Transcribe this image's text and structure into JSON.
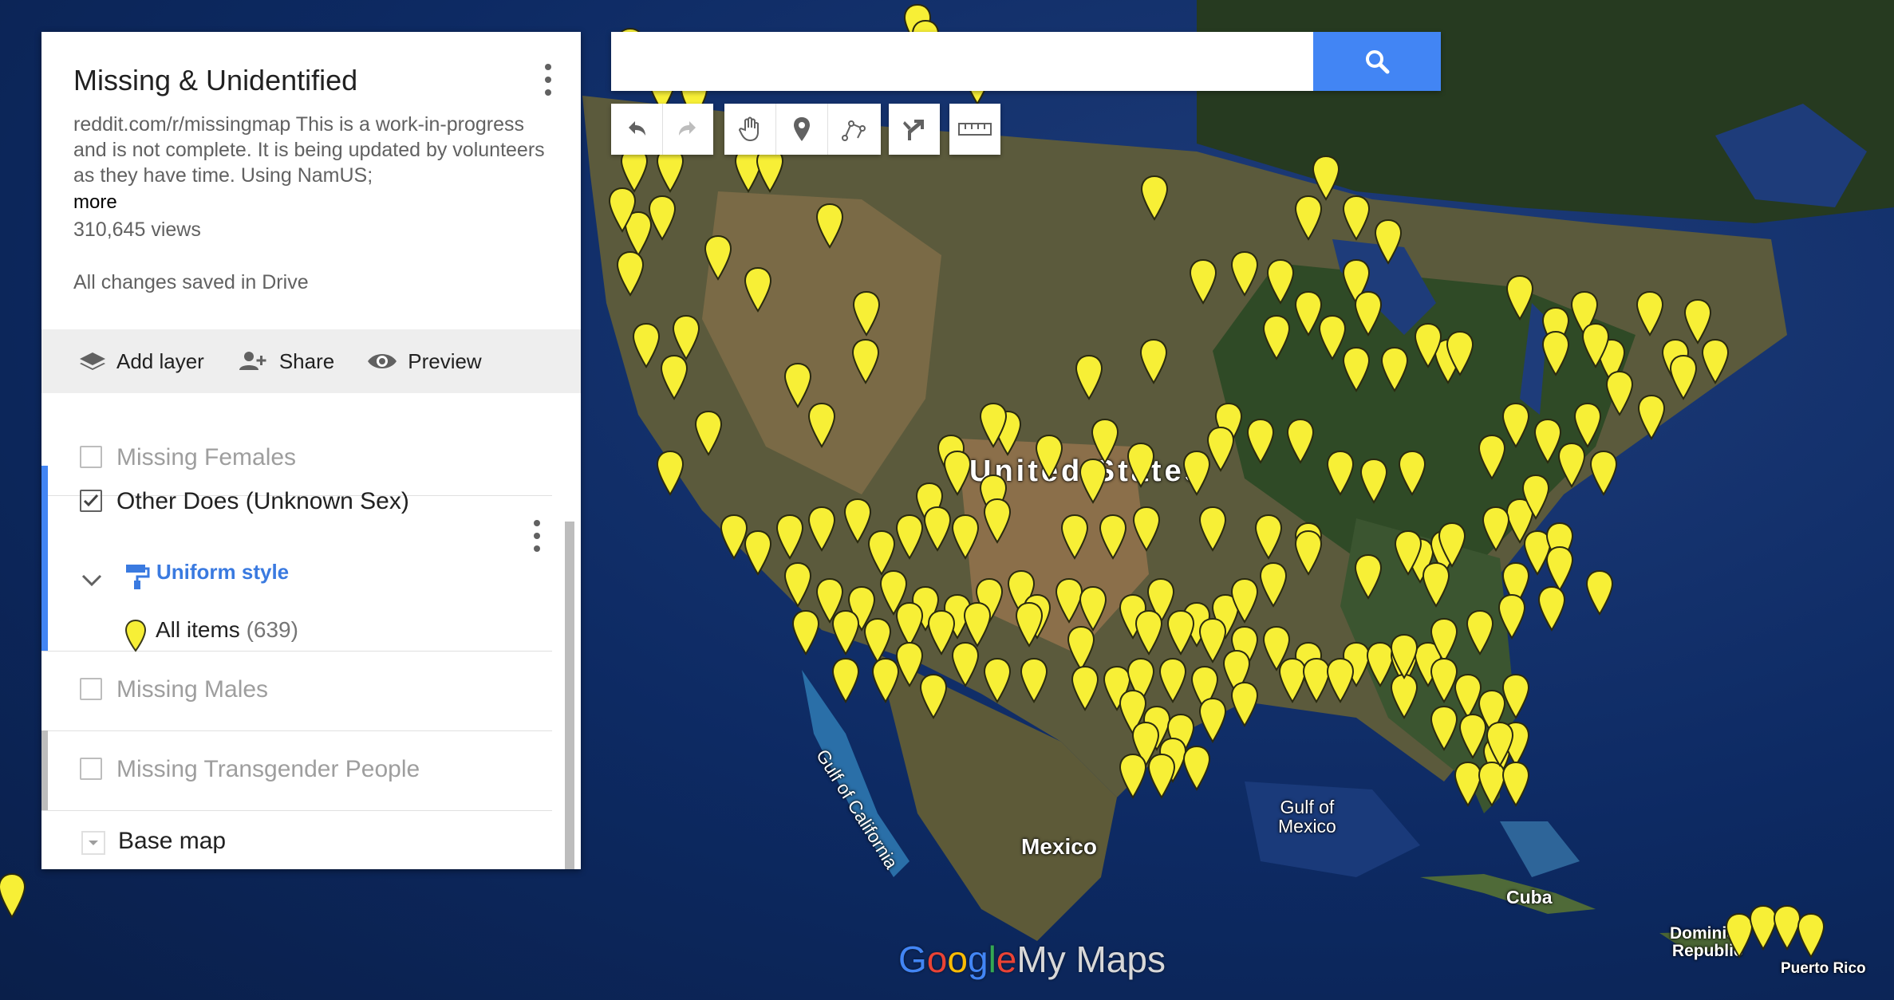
{
  "search": {
    "placeholder": ""
  },
  "panel": {
    "title": "Missing & Unidentified",
    "description": "reddit.com/r/missingmap This is a work-in-progress and is not complete. It is being updated by volunteers as they have time. Using NamUS;",
    "more_label": "more",
    "views": "310,645 views",
    "save_status": "All changes saved in Drive",
    "actions": {
      "add_layer": "Add layer",
      "share": "Share",
      "preview": "Preview"
    },
    "layers": [
      {
        "name": "Missing Females",
        "checked": false
      },
      {
        "name": "Other Does (Unknown Sex)",
        "checked": true,
        "style_label": "Uniform style",
        "items_label": "All items",
        "items_count": "(639)"
      },
      {
        "name": "Missing Males",
        "checked": false
      },
      {
        "name": "Missing Transgender People",
        "checked": false
      }
    ],
    "base_map_label": "Base map"
  },
  "map": {
    "labels": {
      "us": "United States",
      "mexico": "Mexico",
      "gulf_mexico_1": "Gulf of",
      "gulf_mexico_2": "Mexico",
      "gulf_california": "Gulf of California",
      "cuba": "Cuba",
      "dominican_1": "Dominica",
      "dominican_2": "Republic",
      "puerto_rico": "Puerto Rico"
    },
    "marker_color": "#f7ef36",
    "marker_icon": "map-pin-icon"
  },
  "logo": {
    "g1": "G",
    "g2": "o",
    "g3": "o",
    "g4": "g",
    "g5": "l",
    "g6": "e",
    "rest": "My Maps"
  },
  "colors": {
    "accent": "#4285f4",
    "marker": "#f7ef36",
    "ocean": "#0d2a63"
  }
}
